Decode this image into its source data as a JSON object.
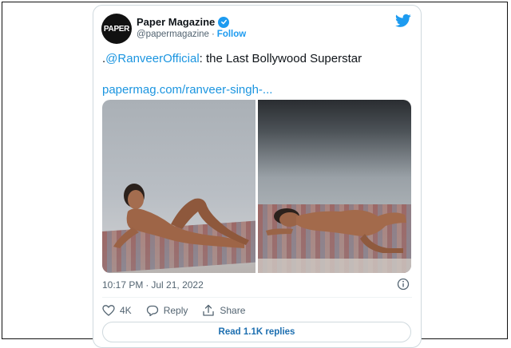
{
  "account": {
    "avatar_text": "PAPER",
    "display_name": "Paper Magazine",
    "handle": "@papermagazine",
    "separator": "·",
    "follow_label": "Follow",
    "verified": true
  },
  "tweet": {
    "text_prefix": ".",
    "mention": "@RanveerOfficial",
    "text_rest": ": the Last Bollywood Superstar",
    "link": "papermag.com/ranveer-singh-...",
    "time": "10:17 PM",
    "time_separator": "·",
    "date": "Jul 21, 2022"
  },
  "actions": {
    "likes": "4K",
    "reply_label": "Reply",
    "share_label": "Share",
    "read_replies_label": "Read 1.1K replies"
  },
  "icons": {
    "brand": "twitter-bird-icon",
    "verified": "verified-badge-icon",
    "info": "info-icon",
    "like": "heart-icon",
    "reply": "reply-icon",
    "share": "share-icon"
  },
  "colors": {
    "accent": "#1d9bf0",
    "link": "#1b95e0",
    "muted": "#536471",
    "text": "#0f1419",
    "border": "#cfd9de"
  }
}
